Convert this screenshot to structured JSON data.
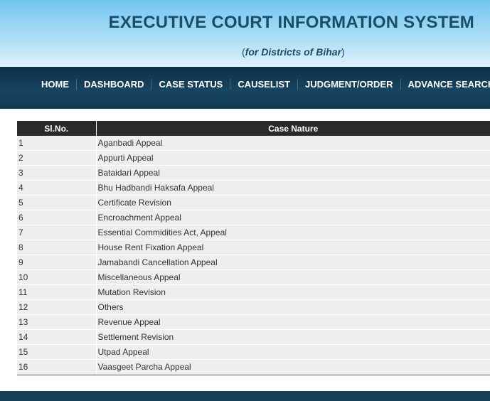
{
  "header": {
    "title": "EXECUTIVE COURT INFORMATION SYSTEM",
    "subtitle_open": "(",
    "subtitle": "for Districts of Bihar",
    "subtitle_close": ")"
  },
  "nav": {
    "items": [
      "HOME",
      "DASHBOARD",
      "CASE STATUS",
      "CAUSELIST",
      "JUDGMENT/ORDER",
      "ADVANCE SEARCH"
    ]
  },
  "table": {
    "columns": [
      "Sl.No.",
      "Case Nature"
    ],
    "rows": [
      [
        "1",
        "Aganbadi Appeal"
      ],
      [
        "2",
        "Appurti Appeal"
      ],
      [
        "3",
        "Bataidari Appeal"
      ],
      [
        "4",
        "Bhu Hadbandi Haksafa Appeal"
      ],
      [
        "5",
        "Certificate Revision"
      ],
      [
        "6",
        "Encroachment Appeal"
      ],
      [
        "7",
        "Essential Commidities Act, Appeal"
      ],
      [
        "8",
        "House Rent Fixation Appeal"
      ],
      [
        "9",
        "Jamabandi Cancellation Appeal"
      ],
      [
        "10",
        "Miscellaneous Appeal"
      ],
      [
        "11",
        "Mutation Revision"
      ],
      [
        "12",
        "Others"
      ],
      [
        "13",
        "Revenue Appeal"
      ],
      [
        "14",
        "Settlement Revision"
      ],
      [
        "15",
        "Utpad Appeal"
      ],
      [
        "16",
        "Vaasgeet Parcha Appeal"
      ]
    ]
  }
}
